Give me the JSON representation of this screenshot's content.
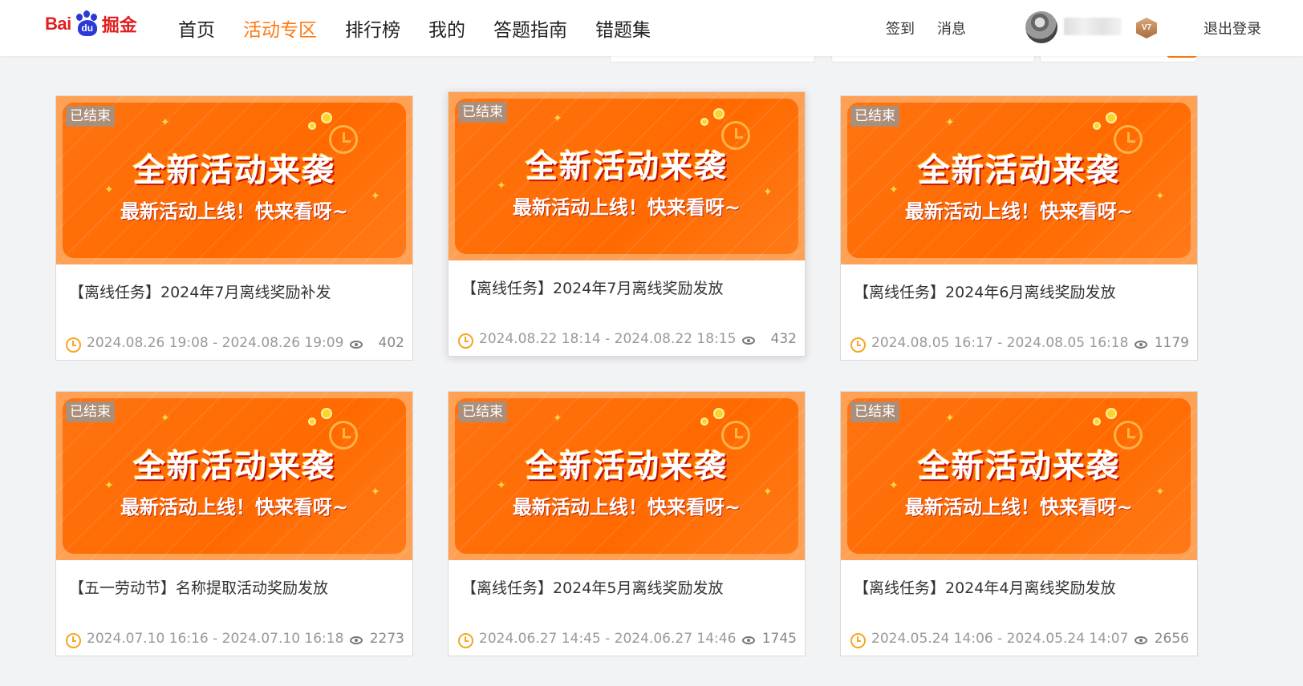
{
  "header": {
    "logo": {
      "brand": "Bai",
      "paw_text": "du",
      "product": "掘金"
    },
    "nav": [
      "首页",
      "活动专区",
      "排行榜",
      "我的",
      "答题指南",
      "错题集"
    ],
    "active_nav": "活动专区",
    "checkin_label": "签到",
    "messages_label": "消息",
    "vip_level": "V7",
    "logout_label": "退出登录"
  },
  "cards": [
    {
      "badge": "已结束",
      "headline": "全新活动来袭",
      "subline": "最新活动上线！快来看呀~",
      "title": "【离线任务】2024年7月离线奖励补发",
      "time": "2024.08.26 19:08 - 2024.08.26 19:09",
      "views": "402"
    },
    {
      "badge": "已结束",
      "headline": "全新活动来袭",
      "subline": "最新活动上线！快来看呀~",
      "title": "【离线任务】2024年7月离线奖励发放",
      "time": "2024.08.22 18:14 - 2024.08.22 18:15",
      "views": "432"
    },
    {
      "badge": "已结束",
      "headline": "全新活动来袭",
      "subline": "最新活动上线！快来看呀~",
      "title": "【离线任务】2024年6月离线奖励发放",
      "time": "2024.08.05 16:17 - 2024.08.05 16:18",
      "views": "1179"
    },
    {
      "badge": "已结束",
      "headline": "全新活动来袭",
      "subline": "最新活动上线！快来看呀~",
      "title": "【五一劳动节】名称提取活动奖励发放",
      "time": "2024.07.10 16:16 - 2024.07.10 16:18",
      "views": "2273"
    },
    {
      "badge": "已结束",
      "headline": "全新活动来袭",
      "subline": "最新活动上线！快来看呀~",
      "title": "【离线任务】2024年5月离线奖励发放",
      "time": "2024.06.27 14:45 - 2024.06.27 14:46",
      "views": "1745"
    },
    {
      "badge": "已结束",
      "headline": "全新活动来袭",
      "subline": "最新活动上线！快来看呀~",
      "title": "【离线任务】2024年4月离线奖励发放",
      "time": "2024.05.24 14:06 - 2024.05.24 14:07",
      "views": "2656"
    }
  ],
  "colors": {
    "accent": "#ff7a12",
    "brand_red": "#e21f1f",
    "brand_blue": "#2a3ad6",
    "banner_orange": "#ff6a00",
    "time_icon": "#f5a623"
  }
}
